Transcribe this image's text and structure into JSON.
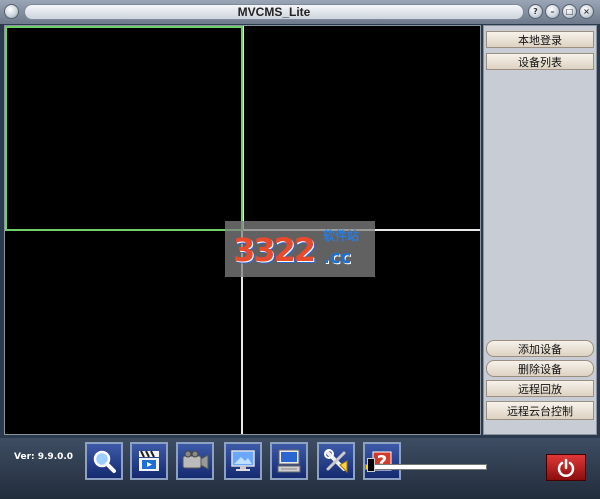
{
  "window": {
    "title": "MVCMS_Lite",
    "buttons": [
      "help",
      "minimize",
      "maximize",
      "close"
    ]
  },
  "right_panel": {
    "top_buttons": [
      "本地登录",
      "设备列表"
    ],
    "bottom_buttons": [
      "添加设备",
      "删除设备",
      "远程回放",
      "远程云台控制"
    ]
  },
  "video_grid": {
    "rows": 2,
    "cols": 2,
    "selected_cell": 1
  },
  "watermark": {
    "number": "3322",
    "domain": ".cc",
    "chinese": "软件站"
  },
  "bottom_bar": {
    "version": "Ver: 9.9.0.0",
    "tools": [
      "search-icon",
      "video-clip-icon",
      "camera-icon",
      "monitor-icon",
      "display-settings-icon",
      "tools-icon",
      "help-icon"
    ],
    "volume_level": 0.05
  },
  "colors": {
    "selected_cell_border": "#6fd06a",
    "power_button": "#c01818"
  }
}
